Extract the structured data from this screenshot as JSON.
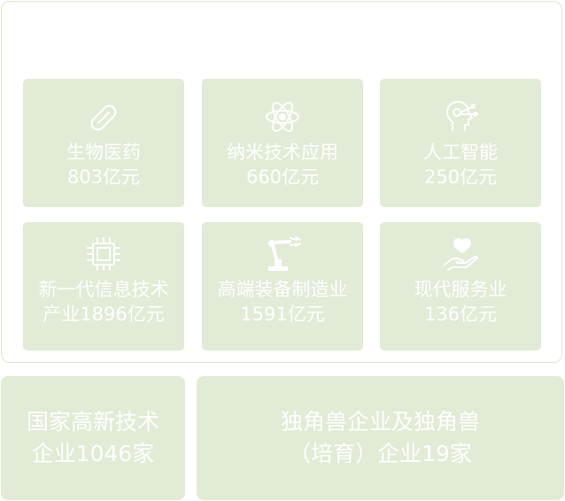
{
  "industries": [
    {
      "name": "生物医药",
      "value": "803亿元",
      "icon": "capsule-icon"
    },
    {
      "name": "纳米技术应用",
      "value": "660亿元",
      "icon": "atom-icon"
    },
    {
      "name": "人工智能",
      "value": "250亿元",
      "icon": "ai-head-icon"
    },
    {
      "name": "新一代信息技术",
      "value": "产业1896亿元",
      "icon": "chip-icon"
    },
    {
      "name": "高端装备制造业",
      "value": "1591亿元",
      "icon": "robot-arm-icon"
    },
    {
      "name": "现代服务业",
      "value": "136亿元",
      "icon": "heart-hand-icon"
    }
  ],
  "enterprises": {
    "high_tech": {
      "line1": "国家高新技术",
      "line2": "企业1046家"
    },
    "unicorn": {
      "line1": "独角兽企业及独角兽",
      "line2": "（培育）企业19家"
    }
  },
  "colors": {
    "card": "#e1ebd5",
    "text": "#ffffff",
    "border": "#dde7cf"
  }
}
